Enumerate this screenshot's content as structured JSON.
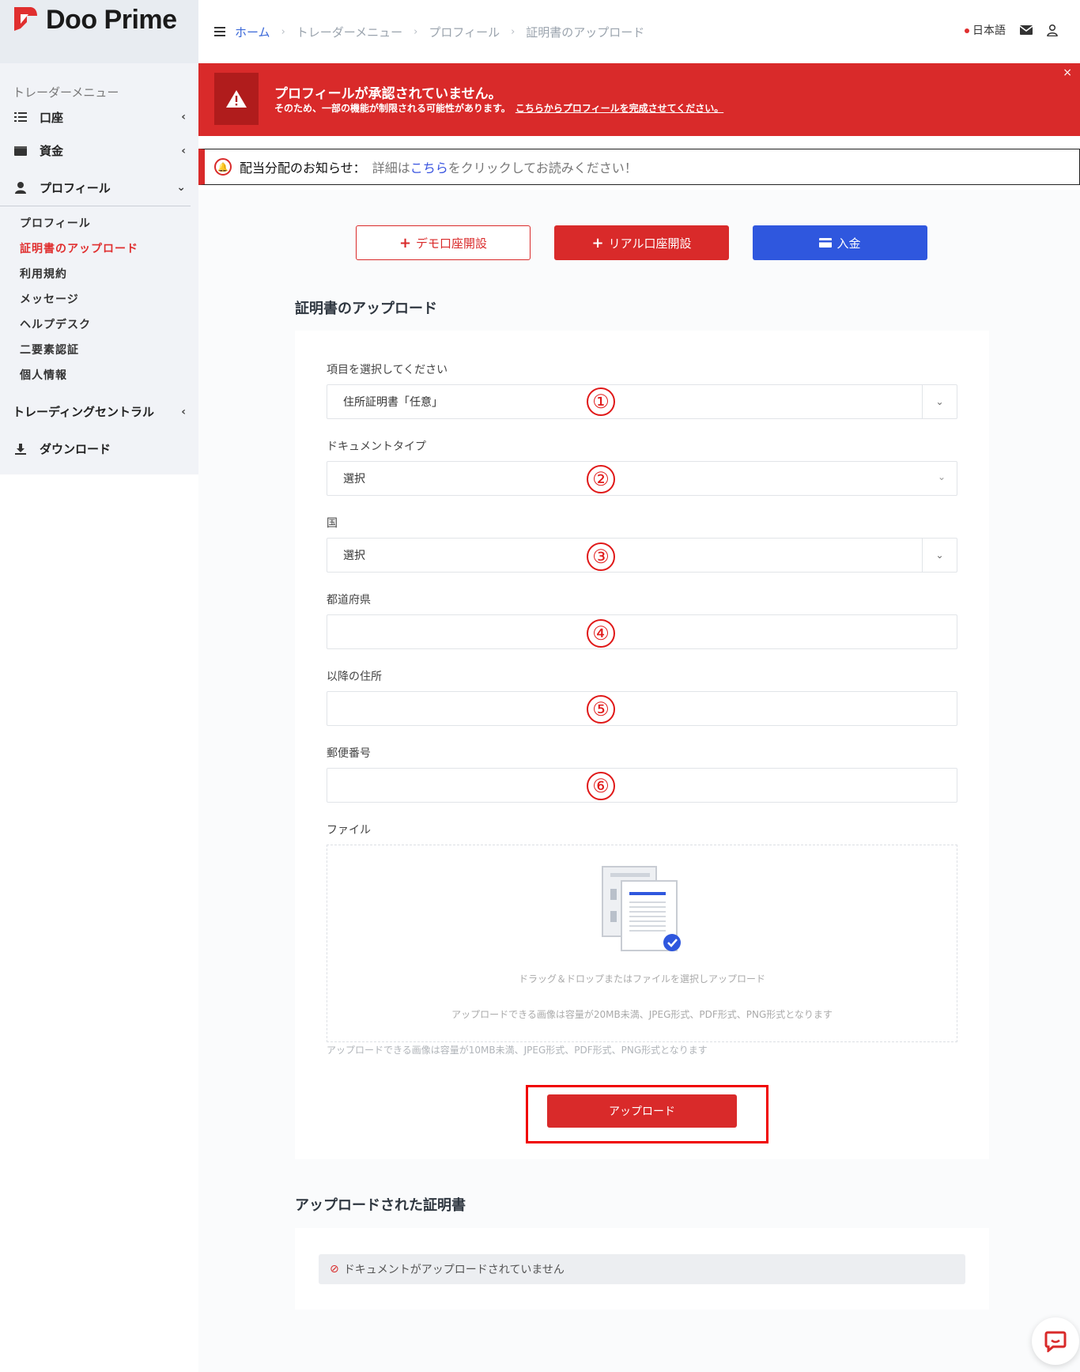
{
  "brand": {
    "name": "Doo Prime",
    "accent": "#d92a2a"
  },
  "sidebar": {
    "menu_title": "トレーダーメニュー",
    "items": [
      {
        "label": "口座",
        "icon": "list-icon"
      },
      {
        "label": "資金",
        "icon": "wallet-icon"
      },
      {
        "label": "プロフィール",
        "icon": "user-icon"
      }
    ],
    "sub_items": [
      "プロフィール",
      "証明書のアップロード",
      "利用規約",
      "メッセージ",
      "ヘルプデスク",
      "二要素認証",
      "個人情報"
    ],
    "trading_central": "トレーディングセントラル",
    "download": "ダウンロード"
  },
  "breadcrumb": [
    "ホーム",
    "トレーダーメニュー",
    "プロフィール",
    "証明書のアップロード"
  ],
  "header": {
    "language": "日本語"
  },
  "alert": {
    "title": "プロフィールが承認されていません。",
    "text": "そのため、一部の機能が制限される可能性があります。",
    "link": "こちらからプロフィールを完成させてください。",
    "close": "×"
  },
  "notice": {
    "title": "配当分配のお知らせ：",
    "text_before": "詳細は",
    "link": "こちら",
    "text_after": "をクリックしてお読みください！"
  },
  "actions": {
    "demo": "デモ口座開設",
    "real": "リアル口座開設",
    "deposit": "入金"
  },
  "form": {
    "title": "証明書のアップロード",
    "item_label": "項目を選択してください",
    "item_value": "住所証明書「任意」",
    "doc_type_label": "ドキュメントタイプ",
    "doc_type_value": "選択",
    "country_label": "国",
    "country_value": "選択",
    "prefecture_label": "都道府県",
    "address_label": "以降の住所",
    "postal_label": "郵便番号",
    "file_label": "ファイル",
    "dropzone_text": "ドラッグ＆ドロップまたはファイルを選択しアップロード",
    "dropzone_hint": "アップロードできる画像は容量が20MB未満、JPEG形式、PDF形式、PNG形式となります",
    "file_hint": "アップロードできる画像は容量が10MB未満、JPEG形式、PDF形式、PNG形式となります",
    "upload_button": "アップロード",
    "markers": [
      "①",
      "②",
      "③",
      "④",
      "⑤",
      "⑥"
    ]
  },
  "uploaded": {
    "title": "アップロードされた証明書",
    "empty": "ドキュメントがアップロードされていません"
  }
}
